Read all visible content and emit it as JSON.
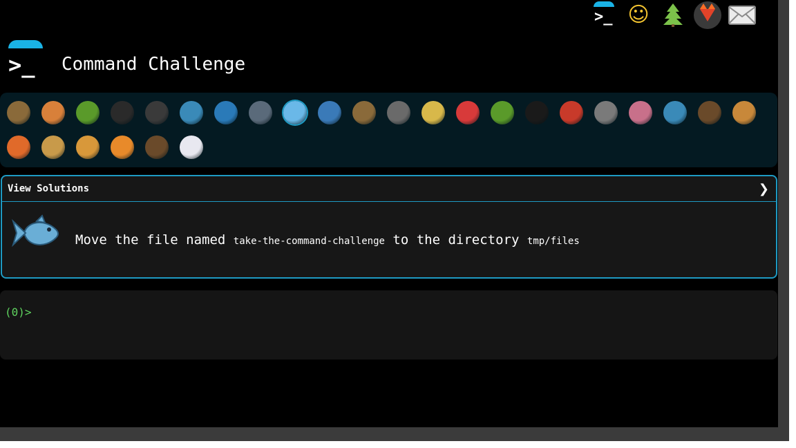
{
  "app": {
    "title": "Command Challenge"
  },
  "nav": {
    "items": [
      {
        "name": "terminal-icon",
        "glyph": ">_"
      },
      {
        "name": "shushing-face-icon",
        "glyph": "🤫"
      },
      {
        "name": "tree-icon",
        "glyph": "🌲"
      },
      {
        "name": "gitlab-icon",
        "glyph": ""
      },
      {
        "name": "mail-icon",
        "glyph": ""
      }
    ]
  },
  "animals": [
    {
      "name": "snail-icon",
      "color": "#8a6a3a"
    },
    {
      "name": "butterfly-icon",
      "color": "#d8803a"
    },
    {
      "name": "caterpillar-icon",
      "color": "#5a9a2a"
    },
    {
      "name": "ant-icon",
      "color": "#2a2a2a"
    },
    {
      "name": "spider-web-icon",
      "color": "#3a3a3a"
    },
    {
      "name": "whale-icon",
      "color": "#3a8ab8"
    },
    {
      "name": "shark-icon",
      "color": "#2a7ab8"
    },
    {
      "name": "dolphin-icon",
      "color": "#5a6a7a"
    },
    {
      "name": "fish-icon",
      "color": "#6ab8e8"
    },
    {
      "name": "tropical-fish-icon",
      "color": "#3a7ab8"
    },
    {
      "name": "blowfish-icon",
      "color": "#8a6a3a"
    },
    {
      "name": "wolf-icon",
      "color": "#6a6a6a"
    },
    {
      "name": "bee-icon",
      "color": "#d8b84a"
    },
    {
      "name": "ladybug-icon",
      "color": "#d83a3a"
    },
    {
      "name": "cricket-icon",
      "color": "#5a9a2a"
    },
    {
      "name": "spider-icon",
      "color": "#1a1a1a"
    },
    {
      "name": "scorpion-icon",
      "color": "#c83a2a"
    },
    {
      "name": "fly-icon",
      "color": "#7a7a7a"
    },
    {
      "name": "worm-icon",
      "color": "#c8708a"
    },
    {
      "name": "microbe-icon",
      "color": "#3a8ab8"
    },
    {
      "name": "monkey-icon",
      "color": "#6a4a2a"
    },
    {
      "name": "dog-icon",
      "color": "#c8883a"
    },
    {
      "name": "fox-icon",
      "color": "#e06a2a"
    },
    {
      "name": "cat-icon",
      "color": "#c89a4a"
    },
    {
      "name": "lion-icon",
      "color": "#d8983a"
    },
    {
      "name": "tiger-icon",
      "color": "#e88a2a"
    },
    {
      "name": "horse-icon",
      "color": "#6a4a2a"
    },
    {
      "name": "unicorn-icon",
      "color": "#e8e8f0"
    }
  ],
  "card": {
    "header_label": "View Solutions",
    "chevron": "❯",
    "task_prefix": "Move the file named",
    "task_file": "take-the-command-challenge",
    "task_middle": "to the directory",
    "task_dir": "tmp/files"
  },
  "terminal": {
    "prompt": "(0)>"
  },
  "colors": {
    "accent": "#1e9bc4",
    "prompt_green": "#5fd35f",
    "animals_bg": "#041a22",
    "card_bg": "#171717"
  }
}
